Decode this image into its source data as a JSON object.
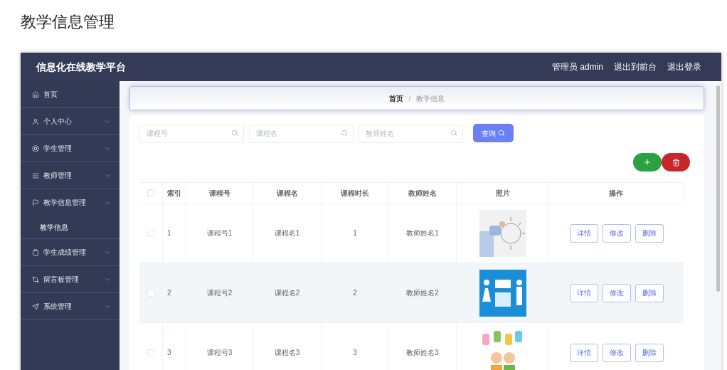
{
  "page_title": "教学信息管理",
  "header": {
    "title": "信息化在线教学平台",
    "links": [
      "管理员 admin",
      "退出到前台",
      "退出登录"
    ]
  },
  "sidebar": {
    "items": [
      {
        "label": "首页"
      },
      {
        "label": "个人中心",
        "expanded": false
      },
      {
        "label": "学生管理",
        "expanded": false
      },
      {
        "label": "教师管理",
        "expanded": false
      },
      {
        "label": "教学信息管理",
        "expanded": true,
        "children": [
          {
            "label": "教学信息"
          }
        ]
      },
      {
        "label": "学生成绩管理",
        "expanded": false
      },
      {
        "label": "留言板管理",
        "expanded": false
      },
      {
        "label": "系统管理",
        "expanded": false
      }
    ]
  },
  "breadcrumb": {
    "items": [
      "首页",
      "教学信息"
    ],
    "separator": "/"
  },
  "search": {
    "fields": [
      {
        "placeholder": "课程号"
      },
      {
        "placeholder": "课程名"
      },
      {
        "placeholder": "教师姓名"
      }
    ],
    "button": "查询"
  },
  "table": {
    "all_checked": false,
    "columns": [
      "索引",
      "课程号",
      "课程名",
      "课程时长",
      "教师姓名",
      "照片",
      "操作"
    ],
    "rows": [
      {
        "checked": false,
        "highlighted": false,
        "cells": [
          "1",
          "课程号1",
          "课程名1",
          "1",
          "教师姓名1"
        ],
        "actions": [
          "详情",
          "修改",
          "删除"
        ]
      },
      {
        "checked": false,
        "highlighted": true,
        "cells": [
          "2",
          "课程号2",
          "课程名2",
          "2",
          "教师姓名2"
        ],
        "actions": [
          "详情",
          "修改",
          "删除"
        ]
      },
      {
        "checked": false,
        "highlighted": false,
        "cells": [
          "3",
          "课程号3",
          "课程名3",
          "3",
          "教师姓名3"
        ],
        "actions": [
          "详情",
          "修改",
          "删除"
        ]
      }
    ]
  }
}
